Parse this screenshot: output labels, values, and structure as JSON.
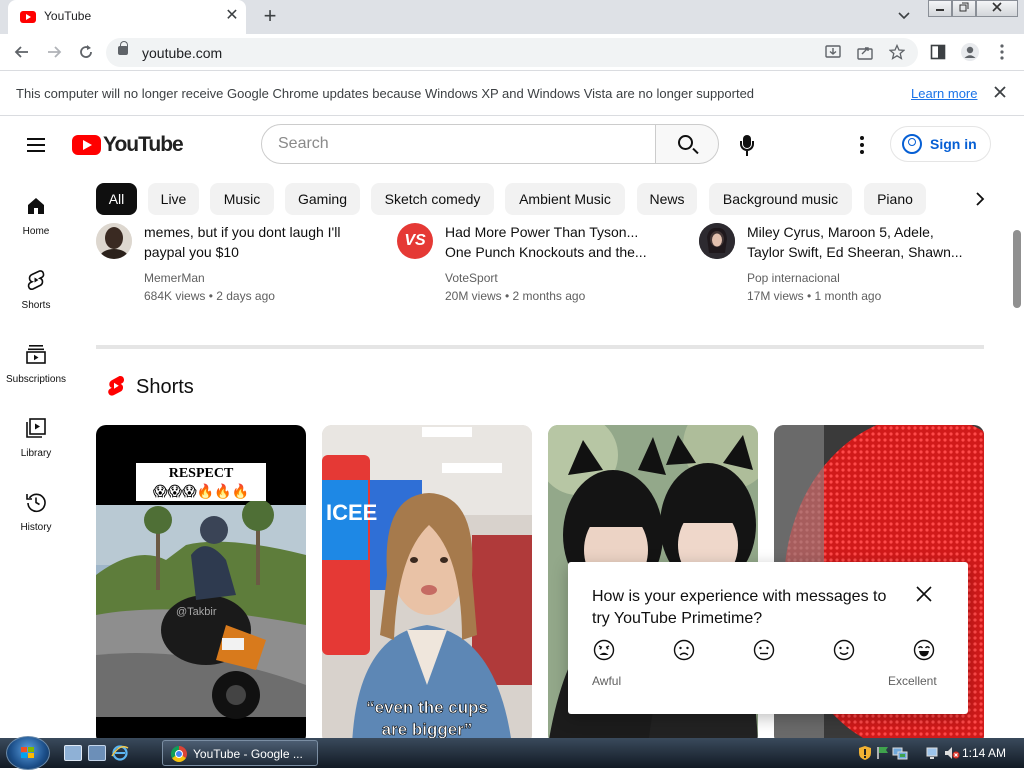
{
  "browser": {
    "tab_title": "YouTube",
    "tab_close_glyph": "✕",
    "new_tab_glyph": "+",
    "url": "youtube.com",
    "infobar_message": "This computer will no longer receive Google Chrome updates because Windows XP and Windows Vista are no longer supported",
    "infobar_link": "Learn more"
  },
  "youtube": {
    "logo_text": "YouTube",
    "search_placeholder": "Search",
    "sign_in": "Sign in",
    "guide": [
      {
        "label": "Home",
        "icon": "home-icon"
      },
      {
        "label": "Shorts",
        "icon": "shorts-icon"
      },
      {
        "label": "Subscriptions",
        "icon": "subscriptions-icon"
      },
      {
        "label": "Library",
        "icon": "library-icon"
      },
      {
        "label": "History",
        "icon": "history-icon"
      }
    ],
    "chips": [
      "All",
      "Live",
      "Music",
      "Gaming",
      "Sketch comedy",
      "Ambient Music",
      "News",
      "Background music",
      "Piano"
    ],
    "videos": [
      {
        "title_line1": "memes, but if you dont laugh I'll",
        "title_line2": "paypal you $10",
        "channel": "MemerMan",
        "meta": "684K views • 2 days ago"
      },
      {
        "title_line1": "Had More Power Than Tyson...",
        "title_line2": "One Punch Knockouts and the...",
        "channel": "VoteSport",
        "meta": "20M views • 2 months ago",
        "avatar_text": "VS"
      },
      {
        "title_line1": "Miley Cyrus, Maroon 5, Adele,",
        "title_line2": "Taylor Swift, Ed Sheeran, Shawn...",
        "channel": "Pop internacional",
        "meta": "17M views • 1 month ago"
      }
    ],
    "shorts_heading": "Shorts",
    "shorts": [
      {
        "overlay_top": "RESPECT",
        "overlay_emoji": "😱😱😱🔥🔥🔥",
        "watermark": "@Takbir"
      },
      {
        "caption_line1": "“even the cups",
        "caption_line2": "are bigger”",
        "cup_text": "ICEE"
      },
      {},
      {}
    ],
    "survey": {
      "question": "How is your experience with messages to try YouTube Primetime?",
      "close_glyph": "✕",
      "low_label": "Awful",
      "high_label": "Excellent",
      "faces": [
        "awful-face-icon",
        "bad-face-icon",
        "neutral-face-icon",
        "good-face-icon",
        "excellent-face-icon"
      ]
    }
  },
  "taskbar": {
    "task_label": "YouTube - Google ...",
    "clock": "1:14 AM"
  },
  "colors": {
    "youtube_red": "#ff0000",
    "link_blue": "#065fd4",
    "chrome_frame": "#dee1e6"
  }
}
